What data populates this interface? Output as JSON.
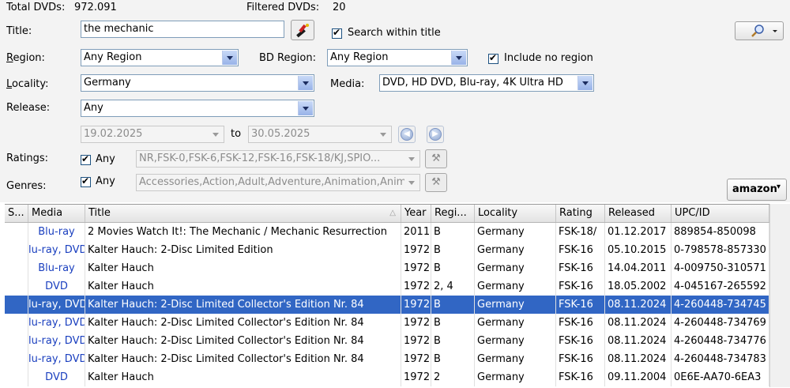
{
  "header": {
    "total_label": "Total DVDs:",
    "total_value": "972.091",
    "filtered_label": "Filtered DVDs:",
    "filtered_value": "20"
  },
  "filters": {
    "title_label": "Title:",
    "title_value": "the mechanic",
    "search_within_label": "Search within title",
    "region_label_first": "R",
    "region_label_rest": "egion:",
    "region_value": "Any Region",
    "bd_region_label": "BD Region:",
    "bd_region_value": "Any Region",
    "include_no_region_label": "Include no region",
    "locality_label_first": "L",
    "locality_label_rest": "ocality:",
    "locality_value": "Germany",
    "media_label": "Media:",
    "media_value": "DVD, HD DVD, Blu-ray, 4K Ultra HD",
    "release_label": "Release:",
    "release_value": "Any",
    "date_from": "19.02.2025",
    "date_to_label": "to",
    "date_to": "30.05.2025",
    "ratings_label": "Ratings:",
    "ratings_any": "Any",
    "ratings_value": "NR,FSK-0,FSK-6,FSK-12,FSK-16,FSK-18/KJ,SPIO...",
    "genres_label": "Genres:",
    "genres_any": "Any",
    "genres_value": "Accessories,Action,Adult,Adventure,Animation,Anim...",
    "amazon_label": "amazon"
  },
  "table": {
    "columns": [
      "S...",
      "Media",
      "Title",
      "Year",
      "Regi...",
      "Locality",
      "Rating",
      "Released",
      "UPC/ID"
    ],
    "rows": [
      {
        "media": "Blu-ray",
        "title": "2 Movies Watch It!: The Mechanic / Mechanic Resurrection",
        "year": "2011",
        "region": "B",
        "locality": "Germany",
        "rating": "FSK-18/",
        "released": "01.12.2017",
        "upc": "889854-850098"
      },
      {
        "media": "lu-ray, DVD",
        "title": "Kalter Hauch: 2-Disc Limited Edition",
        "year": "1972",
        "region": "B",
        "locality": "Germany",
        "rating": "FSK-16",
        "released": "05.10.2015",
        "upc": "0-798578-857330"
      },
      {
        "media": "Blu-ray",
        "title": "Kalter Hauch",
        "year": "1972",
        "region": "B",
        "locality": "Germany",
        "rating": "FSK-16",
        "released": "14.04.2011",
        "upc": "4-009750-310571"
      },
      {
        "media": "DVD",
        "title": "Kalter Hauch",
        "year": "1972",
        "region": "2, 4",
        "locality": "Germany",
        "rating": "FSK-16",
        "released": "18.05.2002",
        "upc": "4-045167-265592"
      },
      {
        "media": "lu-ray, DVD",
        "title": "Kalter Hauch: 2-Disc Limited Collector's Edition Nr. 84",
        "year": "1972",
        "region": "B",
        "locality": "Germany",
        "rating": "FSK-16",
        "released": "08.11.2024",
        "upc": "4-260448-734745"
      },
      {
        "media": "lu-ray, DVD",
        "title": "Kalter Hauch: 2-Disc Limited Collector's Edition Nr. 84",
        "year": "1972",
        "region": "B",
        "locality": "Germany",
        "rating": "FSK-16",
        "released": "08.11.2024",
        "upc": "4-260448-734769"
      },
      {
        "media": "lu-ray, DVD",
        "title": "Kalter Hauch: 2-Disc Limited Collector's Edition Nr. 84",
        "year": "1972",
        "region": "B",
        "locality": "Germany",
        "rating": "FSK-16",
        "released": "08.11.2024",
        "upc": "4-260448-734776"
      },
      {
        "media": "lu-ray, DVD",
        "title": "Kalter Hauch: 2-Disc Limited Collector's Edition Nr. 84",
        "year": "1972",
        "region": "B",
        "locality": "Germany",
        "rating": "FSK-16",
        "released": "08.11.2024",
        "upc": "4-260448-734783"
      },
      {
        "media": "DVD",
        "title": "Kalter Hauch",
        "year": "1972",
        "region": "2",
        "locality": "Germany",
        "rating": "FSK-16",
        "released": "09.11.2004",
        "upc": "0E6E-AA70-6EA3"
      }
    ],
    "selected_row": 4
  },
  "icons": {
    "clear": "paint-brush-icon",
    "search": "magnifier-icon",
    "prev": "arrow-left-icon",
    "next": "arrow-right-icon",
    "tool": "tools-icon",
    "sort": "sort-ascending-icon"
  },
  "colors": {
    "selection": "#3166c4",
    "media_link": "#1a3fbf"
  }
}
